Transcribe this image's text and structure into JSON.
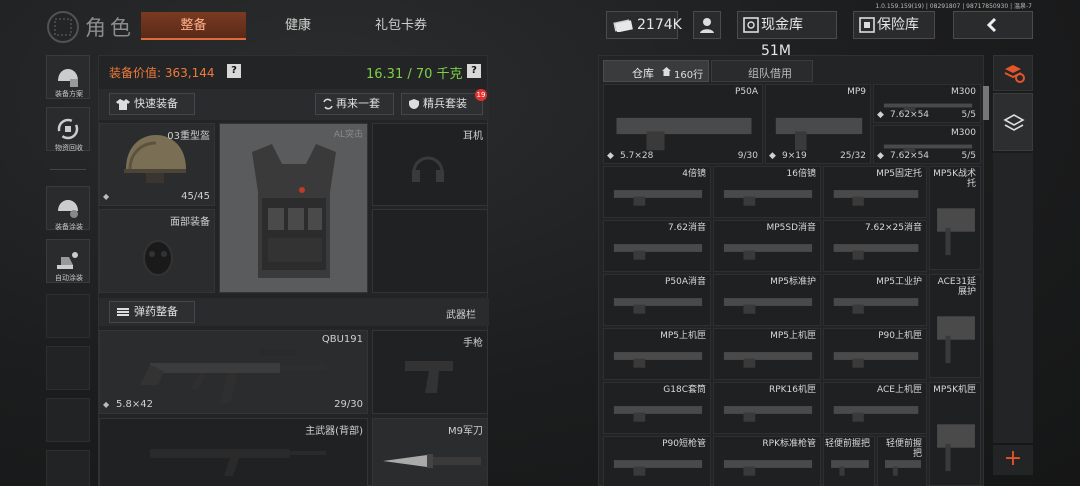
{
  "header": {
    "title": "角色",
    "version": "1.0.159.159(19) | 08291807 | 98717850930 | 温泉-7",
    "tabs": [
      {
        "label": "整备",
        "active": true
      },
      {
        "label": "健康",
        "active": false
      },
      {
        "label": "礼包卡券",
        "active": false
      }
    ],
    "money": "2174K",
    "cash_vault": "现金库 51M",
    "safe_box": "保险库"
  },
  "sidebar": [
    {
      "label": "装备方案"
    },
    {
      "label": "物资回收"
    },
    {
      "label": "装备涂装"
    },
    {
      "label": "自动涂装"
    }
  ],
  "equipment": {
    "value_label": "装备价值: 363,144",
    "weight": "16.31 / 70 千克",
    "quick_equip": "快速装备",
    "again": "再来一套",
    "elite": "精兵套装",
    "elite_badge": "19",
    "helmet": {
      "name": "03重型盔",
      "durability": "45/45"
    },
    "armor": {
      "name": "AL突击"
    },
    "earphone": "耳机",
    "face": "面部装备",
    "ammo_btn": "弹药整备",
    "weapon_bar": "武器栏",
    "primary": {
      "name": "QBU191",
      "ammo": "5.8×42",
      "count": "29/30"
    },
    "pistol": "手枪",
    "back_weapon": "主武器(背部)",
    "knife": "M9军刀"
  },
  "warehouse": {
    "tab_storage": "仓库",
    "rows": "160行",
    "tab_team": "组队借用",
    "items": [
      {
        "name": "P50A",
        "ammo": "5.7×28",
        "count": "9/30"
      },
      {
        "name": "MP9",
        "ammo": "9×19",
        "count": "25/32"
      },
      {
        "name": "M300",
        "ammo": "7.62×54",
        "count": "5/5"
      },
      {
        "name": "M300",
        "ammo": "7.62×54",
        "count": "5/5"
      },
      {
        "name": "4倍镜"
      },
      {
        "name": "16倍镜"
      },
      {
        "name": "MP5固定托"
      },
      {
        "name": "MP5K战术托"
      },
      {
        "name": "7.62消音"
      },
      {
        "name": "MP5SD消音"
      },
      {
        "name": "7.62×25消音"
      },
      {
        "name": "P50A消音"
      },
      {
        "name": "MP5标准护"
      },
      {
        "name": "MP5工业护"
      },
      {
        "name": "ACE31延展护"
      },
      {
        "name": "MP5上机匣"
      },
      {
        "name": "MP5上机匣"
      },
      {
        "name": "P90上机匣"
      },
      {
        "name": "G18C套筒"
      },
      {
        "name": "RPK16机匣"
      },
      {
        "name": "ACE上机匣"
      },
      {
        "name": "MP5K机匣"
      },
      {
        "name": "P90短枪管"
      },
      {
        "name": "RPK标准枪管"
      },
      {
        "name": "轻便前握把"
      },
      {
        "name": "轻便前握把"
      }
    ]
  },
  "colors": {
    "accent": "#e06a3c",
    "value": "#f07a3a",
    "weight": "#7ed04a",
    "badge": "#e03030"
  }
}
